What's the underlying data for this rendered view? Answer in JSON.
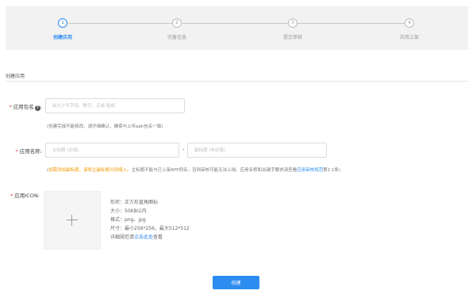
{
  "steps": [
    {
      "number": "1",
      "label": "创建应用",
      "active": true
    },
    {
      "number": "2",
      "label": "完善信息",
      "active": false
    },
    {
      "number": "3",
      "label": "提交审核",
      "active": false
    },
    {
      "number": "4",
      "label": "应用上架",
      "active": false
    }
  ],
  "section_title": "创建应用",
  "package_field": {
    "required_mark": "*",
    "label": "应用包名",
    "help_icon": "?",
    "colon": ":",
    "placeholder": "由大小写字母、数字、点或-组成",
    "hint": "(创建完成不能修改，请仔细确认，确保与上传apk包名一致)"
  },
  "name_field": {
    "required_mark": "*",
    "label": "应用名称:",
    "main_placeholder": "主标题 (必填)",
    "dash": "-",
    "sub_placeholder": "副标题 (非必填)",
    "hint_open": "(",
    "hint_warning": "如需添加副标题，请将主副标题分别填入。",
    "hint_text": "主标题不能与已上架APP同名，否则审核可能无法上线。应用名称和关键字要求请查看",
    "hint_link": "应用审核规范",
    "hint_tail": "第2.1条)"
  },
  "icon_field": {
    "required_mark": "*",
    "label": "应用ICON:",
    "upload_icon": "plus-icon",
    "specs": [
      "形状：正方形直角图标",
      "大小：50KB以内",
      "格式：png、jpg",
      "尺寸：最小256*256，最大512*512"
    ],
    "guide_prefix": "详细规范请",
    "guide_link": "点击此处",
    "guide_suffix": "查看"
  },
  "create_button": "创建",
  "colors": {
    "accent": "#2d8cf0",
    "warning": "#f39800",
    "required": "#e4393c",
    "stepper_bg": "#f2f2f2"
  }
}
